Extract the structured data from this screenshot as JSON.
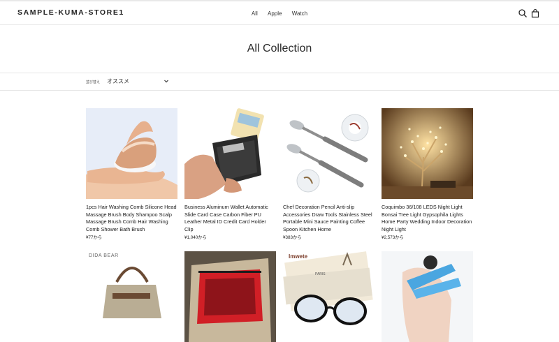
{
  "store": {
    "name": "SAMPLE-KUMA-STORE1"
  },
  "nav": {
    "items": [
      "All",
      "Apple",
      "Watch"
    ]
  },
  "icons": {
    "search": "search-icon",
    "cart": "bag-icon"
  },
  "collection": {
    "title": "All Collection"
  },
  "sort": {
    "label": "並び替え",
    "selected": "オススメ"
  },
  "products": [
    {
      "title": "1pcs Hair Washing Comb Silicone Head Massage Brush Body Shampoo Scalp Massage Brush Comb Hair Washing Comb Shower Bath Brush",
      "price": "¥77から"
    },
    {
      "title": "Business Aluminum Wallet Automatic Slide Card Case Carbon Fiber PU Leather Metal ID Credit Card Holder Clip",
      "price": "¥1,040から"
    },
    {
      "title": "Chef Decoration Pencil Anti-slip Accessories Draw Tools Stainless Steel Portable Mini Sauce Painting Coffee Spoon Kitchen Home",
      "price": "¥383から"
    },
    {
      "title": "Coquimbo 36/108 LEDS Night Light Bonsai Tree Light Gypsophila Lights Home Party Wedding Indoor Decoration Night Light",
      "price": "¥2,573から"
    }
  ],
  "second_row": {
    "brand_label": "DIDA BEAR",
    "glasses_label": "Imwete",
    "paris_label": "PARIS"
  }
}
